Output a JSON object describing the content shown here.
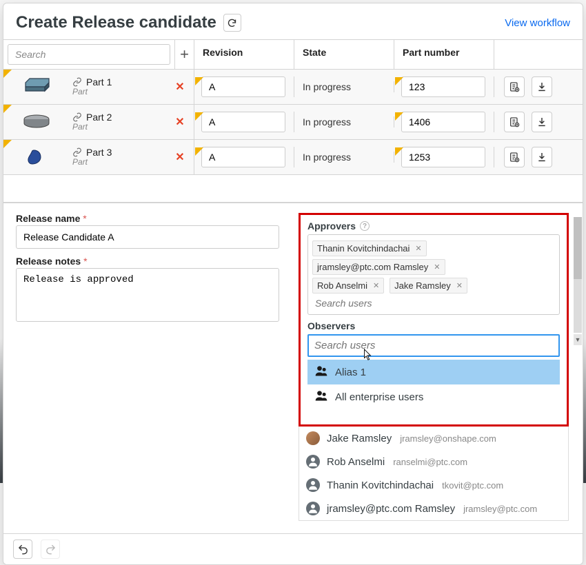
{
  "modal": {
    "title": "Create Release candidate",
    "view_workflow": "View workflow"
  },
  "search": {
    "placeholder": "Search"
  },
  "columns": {
    "revision": "Revision",
    "state": "State",
    "part_number": "Part number"
  },
  "parts": [
    {
      "name": "Part 1",
      "type": "Part",
      "state": "In progress",
      "rev": "A",
      "pn": "123"
    },
    {
      "name": "Part 2",
      "type": "Part",
      "state": "In progress",
      "rev": "A",
      "pn": "1406"
    },
    {
      "name": "Part 3",
      "type": "Part",
      "state": "In progress",
      "rev": "A",
      "pn": "1253"
    }
  ],
  "form": {
    "release_name_label": "Release name",
    "release_name_value": "Release Candidate A",
    "release_notes_label": "Release notes",
    "release_notes_value": "Release is approved"
  },
  "approvers": {
    "label": "Approvers",
    "chips": [
      "Thanin Kovitchindachai",
      "jramsley@ptc.com Ramsley",
      "Rob Anselmi",
      "Jake Ramsley"
    ],
    "search_placeholder": "Search users"
  },
  "observers": {
    "label": "Observers",
    "search_placeholder": "Search users"
  },
  "dropdown": {
    "highlighted": [
      {
        "label": "Alias 1"
      },
      {
        "label": "All enterprise users"
      }
    ],
    "users": [
      {
        "name": "Jake Ramsley",
        "email": "jramsley@onshape.com",
        "avatar": "photo"
      },
      {
        "name": "Rob Anselmi",
        "email": "ranselmi@ptc.com",
        "avatar": "generic"
      },
      {
        "name": "Thanin Kovitchindachai",
        "email": "tkovit@ptc.com",
        "avatar": "generic"
      },
      {
        "name": "jramsley@ptc.com Ramsley",
        "email": "jramsley@ptc.com",
        "avatar": "generic"
      }
    ]
  },
  "required_marker": "*"
}
